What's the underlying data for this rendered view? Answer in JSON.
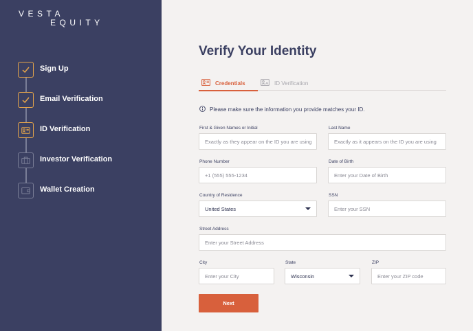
{
  "brand": {
    "line1": "VESTA",
    "line2": "EQUITY"
  },
  "steps": [
    {
      "label": "Sign Up",
      "status": "done",
      "icon": "check-icon"
    },
    {
      "label": "Email Verification",
      "status": "done",
      "icon": "check-icon"
    },
    {
      "label": "ID Verification",
      "status": "current",
      "icon": "id-card-icon"
    },
    {
      "label": "Investor Verification",
      "status": "pending",
      "icon": "briefcase-icon"
    },
    {
      "label": "Wallet Creation",
      "status": "pending",
      "icon": "wallet-icon"
    }
  ],
  "page": {
    "title": "Verify Your Identity"
  },
  "tabs": [
    {
      "label": "Credentials",
      "active": true,
      "icon": "credentials-icon"
    },
    {
      "label": "ID Verification",
      "active": false,
      "icon": "id-photo-icon"
    }
  ],
  "notice": {
    "text": "Please make sure the information you provide matches your ID.",
    "icon": "info-icon"
  },
  "form": {
    "first_name": {
      "label": "First & Given Names or Initial",
      "placeholder": "Exactly as they appear on the ID you are using"
    },
    "last_name": {
      "label": "Last Name",
      "placeholder": "Exactly as it appears on the ID you are using"
    },
    "phone": {
      "label": "Phone Number",
      "placeholder": "+1 (555) 555-1234"
    },
    "dob": {
      "label": "Date of Birth",
      "placeholder": "Enter your Date of Birth"
    },
    "country": {
      "label": "Country of Residence",
      "value": "United States"
    },
    "ssn": {
      "label": "SSN",
      "placeholder": "Enter your SSN"
    },
    "street": {
      "label": "Street Address",
      "placeholder": "Enter your Street Address"
    },
    "city": {
      "label": "City",
      "placeholder": "Enter your City"
    },
    "state": {
      "label": "State",
      "value": "Wisconsin"
    },
    "zip": {
      "label": "ZIP",
      "placeholder": "Enter your ZIP code"
    }
  },
  "actions": {
    "next_label": "Next"
  },
  "colors": {
    "sidebar": "#3b4062",
    "accent": "#d8603c",
    "check": "#e6a54a",
    "background": "#f4f2f1"
  }
}
